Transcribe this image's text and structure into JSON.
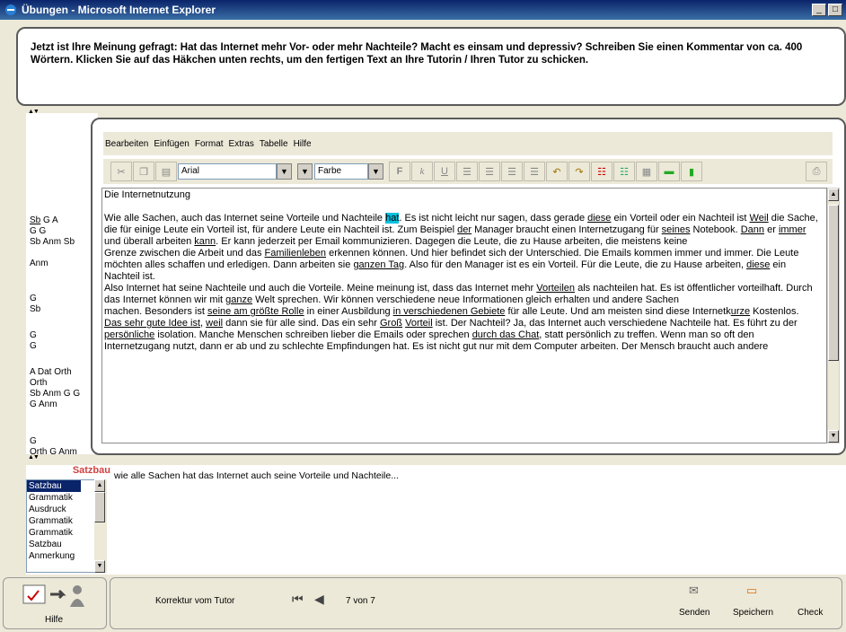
{
  "window": {
    "title": "Übungen - Microsoft Internet Explorer",
    "min": "_",
    "max": "□"
  },
  "task": {
    "text": "Jetzt ist Ihre Meinung gefragt: Hat das Internet mehr Vor- oder mehr Nachteile? Macht es einsam und depressiv? Schreiben Sie einen Kommentar von ca. 400 Wörtern. Klicken Sie auf das Häkchen unten rechts, um den fertigen Text an Ihre Tutorin / Ihren Tutor zu schicken."
  },
  "menu": [
    "Bearbeiten",
    "Einfügen",
    "Format",
    "Extras",
    "Tabelle",
    "Hilfe"
  ],
  "toolbar": {
    "font": "Arial",
    "color": "Farbe",
    "bold": "F",
    "italic": "k",
    "underline": "U"
  },
  "margin_notes": [
    {
      "pre": "",
      "u": "Sb",
      "post": " G A\nG G\nSb Anm Sb"
    },
    {
      "pre": "Anm",
      "u": "",
      "post": ""
    },
    {
      "pre": "G\nSb",
      "u": "",
      "post": ""
    },
    {
      "pre": "G\nG",
      "u": "",
      "post": ""
    },
    {
      "pre": "A Dat Orth\nOrth\nSb Anm G G\nG Anm",
      "u": "",
      "post": ""
    },
    {
      "pre": "G\nOrth G Anm",
      "u": "",
      "post": ""
    }
  ],
  "doc": {
    "title": "Die Internetnutzung",
    "p1_a": "Wie alle Sachen, auch das Internet seine Vorteile und Nachteile ",
    "p1_hl": "hat",
    "p1_b": ". Es ist nicht leicht nur sagen, dass gerade ",
    "p1_u1": "diese",
    "p1_c": " ein Vorteil oder ein Nachteil ist ",
    "p1_u2": "Weil",
    "p1_d": " die Sache, die für einige Leute ein Vorteil ist, für andere Leute ein Nachteil ist. Zum Beispiel ",
    "p1_u3": "der",
    "p1_e": " Manager braucht einen Internetzugang für ",
    "p1_u4": "seines",
    "p1_f": " Notebook. ",
    "p1_u5": "Dann",
    "p1_g": " er ",
    "p1_u6": "immer",
    "p1_h": " und überall arbeiten ",
    "p1_u7": "kann",
    "p1_i": ". Er kann jederzeit per Email kommunizieren. Dagegen die Leute, die zu Hause arbeiten, die meistens keine",
    "p2_a": "Grenze zwischen die Arbeit und das ",
    "p2_u1": "Familienleben",
    "p2_b": " erkennen können. Und hier befindet sich der Unterschied. Die Emails kommen immer und immer. Die Leute",
    "p3_a": "möchten alles schaffen und erledigen. Dann arbeiten sie ",
    "p3_u1": "ganzen Tag",
    "p3_b": ". Also für den Manager ist es ein Vorteil. Für die Leute, die zu Hause arbeiten, ",
    "p3_u2": "diese",
    "p3_c": " ein",
    "p4": "Nachteil ist.",
    "p5_a": "Also Internet hat seine Nachteile und auch die Vorteile. Meine meinung ist, dass das Internet mehr ",
    "p5_u1": "Vorteilen",
    "p5_b": " als nachteilen hat. Es ist öffentlicher vorteilhaft. Durch das Internet können wir mit ",
    "p5_u2": "ganze",
    "p5_c": " Welt sprechen. Wir können verschiedene neue Informationen gleich erhalten und andere Sachen",
    "p6_a": "machen. Besonders ist ",
    "p6_u1": "seine am größte Rolle",
    "p6_b": " in einer Ausbildung ",
    "p6_u2": "in verschiedenen Gebiete",
    "p6_c": " für alle Leute. Und am meisten sind diese Internetk",
    "p6_u3": "urze",
    "p6_d": " Kostenlos.",
    "p7_u1": "Das sehr gute Idee ist",
    "p7_a": ", ",
    "p7_u2": "weil",
    "p7_b": " dann sie für alle sind. Das ein sehr ",
    "p7_u3": "Groß",
    "p7_c": " ",
    "p7_u4": "Vorteil",
    "p7_d": " ist. Der Nachteil? Ja, das Internet auch verschiedene Nachteile hat. Es führt zu der ",
    "p7_u5": "persönliche",
    "p7_e": " isolation. Manche Menschen schreiben lieber die Emails oder sprechen ",
    "p7_u6": "durch das Chat",
    "p7_f": ", statt persönlich zu treffen. Wenn man so oft den",
    "p8": "Internetzugang nutzt, dann er ab und zu schlechte Empfindungen hat. Es ist nicht gut nur mit dem Computer arbeiten. Der Mensch braucht auch andere"
  },
  "categories": {
    "title": "Satzbau",
    "items": [
      "Satzbau",
      "Grammatik",
      "Ausdruck",
      "Grammatik",
      "Grammatik",
      "Satzbau",
      "Anmerkung"
    ]
  },
  "comment": "wie alle Sachen hat das Internet auch seine Vorteile und Nachteile...",
  "footer": {
    "help": "Hilfe",
    "correction": "Korrektur vom Tutor",
    "pager": "7 von 7",
    "send": "Senden",
    "save": "Speichern",
    "check": "Check"
  }
}
